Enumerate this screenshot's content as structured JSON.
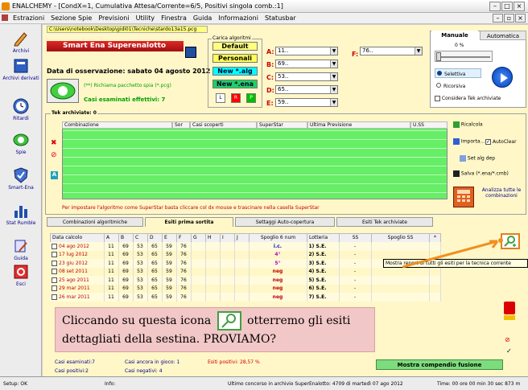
{
  "window": {
    "title": "ENALCHEMY - [CondX=1, Cumulativa Attesa/Corrente=6/5, Positivi singola comb.:1]"
  },
  "menu": [
    "Estrazioni",
    "Sezione Spie",
    "Previsioni",
    "Utility",
    "Finestra",
    "Guida",
    "Informazioni",
    "Statusbar"
  ],
  "sidebar": [
    "Archivi",
    "Archivi derivati",
    "Ritardi",
    "Spie",
    "Smart-Ena",
    "Stat Rumble",
    "Guida",
    "Esci"
  ],
  "path": "C:\\Users\\notebook\\Desktop\\gidi01\\Tecniche\\stardo13a15.pcg",
  "header": {
    "smart_label": "Smart Ena Superenalotto",
    "date_label": "Data di osservazione:  sabato 04 agosto 2012",
    "spy_hint": "(**) Richiama pacchetto spia (*.pcg)",
    "cases_label": "Casi esaminati effettivi: 7"
  },
  "carica": {
    "title": "Carica algoritmi",
    "default": "Default",
    "personali": "Personali",
    "new_alg": "New *.alg",
    "new_ena": "New *.ena",
    "l": "L",
    "r": "R",
    "p": "P"
  },
  "combos": [
    {
      "letter": "A:",
      "value": "11.."
    },
    {
      "letter": "B:",
      "value": "69.."
    },
    {
      "letter": "C:",
      "value": "53.."
    },
    {
      "letter": "D:",
      "value": "65.."
    },
    {
      "letter": "E:",
      "value": "59.."
    }
  ],
  "combo_f": {
    "letter": "F:",
    "value": "76.."
  },
  "right_panel": {
    "tab_manuale": "Manuale",
    "tab_automatica": "Automatica",
    "pct": "0 %",
    "radio_selettiva": "Selettiva",
    "radio_ricorsiva": "Ricorsiva",
    "consider": "Considera Tek archiviate"
  },
  "tek": {
    "title": "Tek archiviate: 0",
    "cols": [
      "Combinazione",
      "Sor",
      "Casi scoperti",
      "SuperStar",
      "Ultima Previsione",
      "U.SS"
    ],
    "ricalcola": "Ricalcola",
    "importa": "Importa...",
    "autoclear": "AutoClear",
    "set_alg": "Set alg dep",
    "salva": "Salva (*.ena/*.cmb)",
    "analizza": "Analizza tutte le combinazioni",
    "hint": "Per impostare l'algoritmo come SuperStar basta cliccare col dx mouse e trascinare nella casella SuperStar"
  },
  "tabs": [
    "Combinazioni algoritmiche",
    "Esiti prima sortita",
    "Settaggi Auto-copertura",
    "Esiti Tek archiviate"
  ],
  "esiti": {
    "headers": [
      "Data calcolo",
      "A",
      "B",
      "C",
      "D",
      "E",
      "F",
      "G",
      "H",
      "I",
      "J",
      "Spoglio 6 num",
      "Lotteria",
      "SS",
      "Spoglio SS",
      "*"
    ],
    "rows": [
      {
        "data": "04 ago 2012",
        "n": [
          "11",
          "69",
          "53",
          "65",
          "59",
          "76"
        ],
        "spoglio": "i.c.",
        "lotteria": "1) S.E.",
        "ss": "-"
      },
      {
        "data": "17 lug 2012",
        "n": [
          "11",
          "69",
          "53",
          "65",
          "59",
          "76"
        ],
        "spoglio": "4°",
        "lotteria": "2) S.E.",
        "ss": "-"
      },
      {
        "data": "23 giu 2012",
        "n": [
          "11",
          "69",
          "53",
          "65",
          "59",
          "76"
        ],
        "spoglio": "5°",
        "lotteria": "3) S.E.",
        "ss": "-"
      },
      {
        "data": "08 set 2011",
        "n": [
          "11",
          "69",
          "53",
          "65",
          "59",
          "76"
        ],
        "spoglio": "neg",
        "lotteria": "4) S.E.",
        "ss": "-"
      },
      {
        "data": "25 ago 2011",
        "n": [
          "11",
          "69",
          "53",
          "65",
          "59",
          "76"
        ],
        "spoglio": "neg",
        "lotteria": "5) S.E.",
        "ss": "-"
      },
      {
        "data": "29 mar 2011",
        "n": [
          "11",
          "69",
          "53",
          "65",
          "59",
          "76"
        ],
        "spoglio": "neg",
        "lotteria": "6) S.E.",
        "ss": "-"
      },
      {
        "data": "26 mar 2011",
        "n": [
          "11",
          "69",
          "53",
          "65",
          "59",
          "76"
        ],
        "spoglio": "neg",
        "lotteria": "7) S.E.",
        "ss": "-"
      }
    ]
  },
  "tooltip": "Mostra report di tutti gli esiti per la tecnica corrente",
  "callout": {
    "before": "Cliccando su questa icona",
    "after": "otterremo gli esiti dettagliati della sestina. PROVIAMO?"
  },
  "stats": {
    "esaminati": "Casi esaminati:7",
    "ancora": "Casi ancora in gioco: 1",
    "positivi_pct": "Esiti positivi: 28,57 %",
    "positivi": "Casi positivi:2",
    "negativi": "Casi negativi: 4",
    "compendio": "Mostra compendio fusione"
  },
  "status": {
    "setup": "Setup: OK",
    "info": "Info:",
    "ultimo": "Ultimo concorso in archivio SuperEnalotto: 4709 di martedì 07 ago 2012",
    "time": "Time: 00 ore 00 min 30 sec 873 m"
  }
}
